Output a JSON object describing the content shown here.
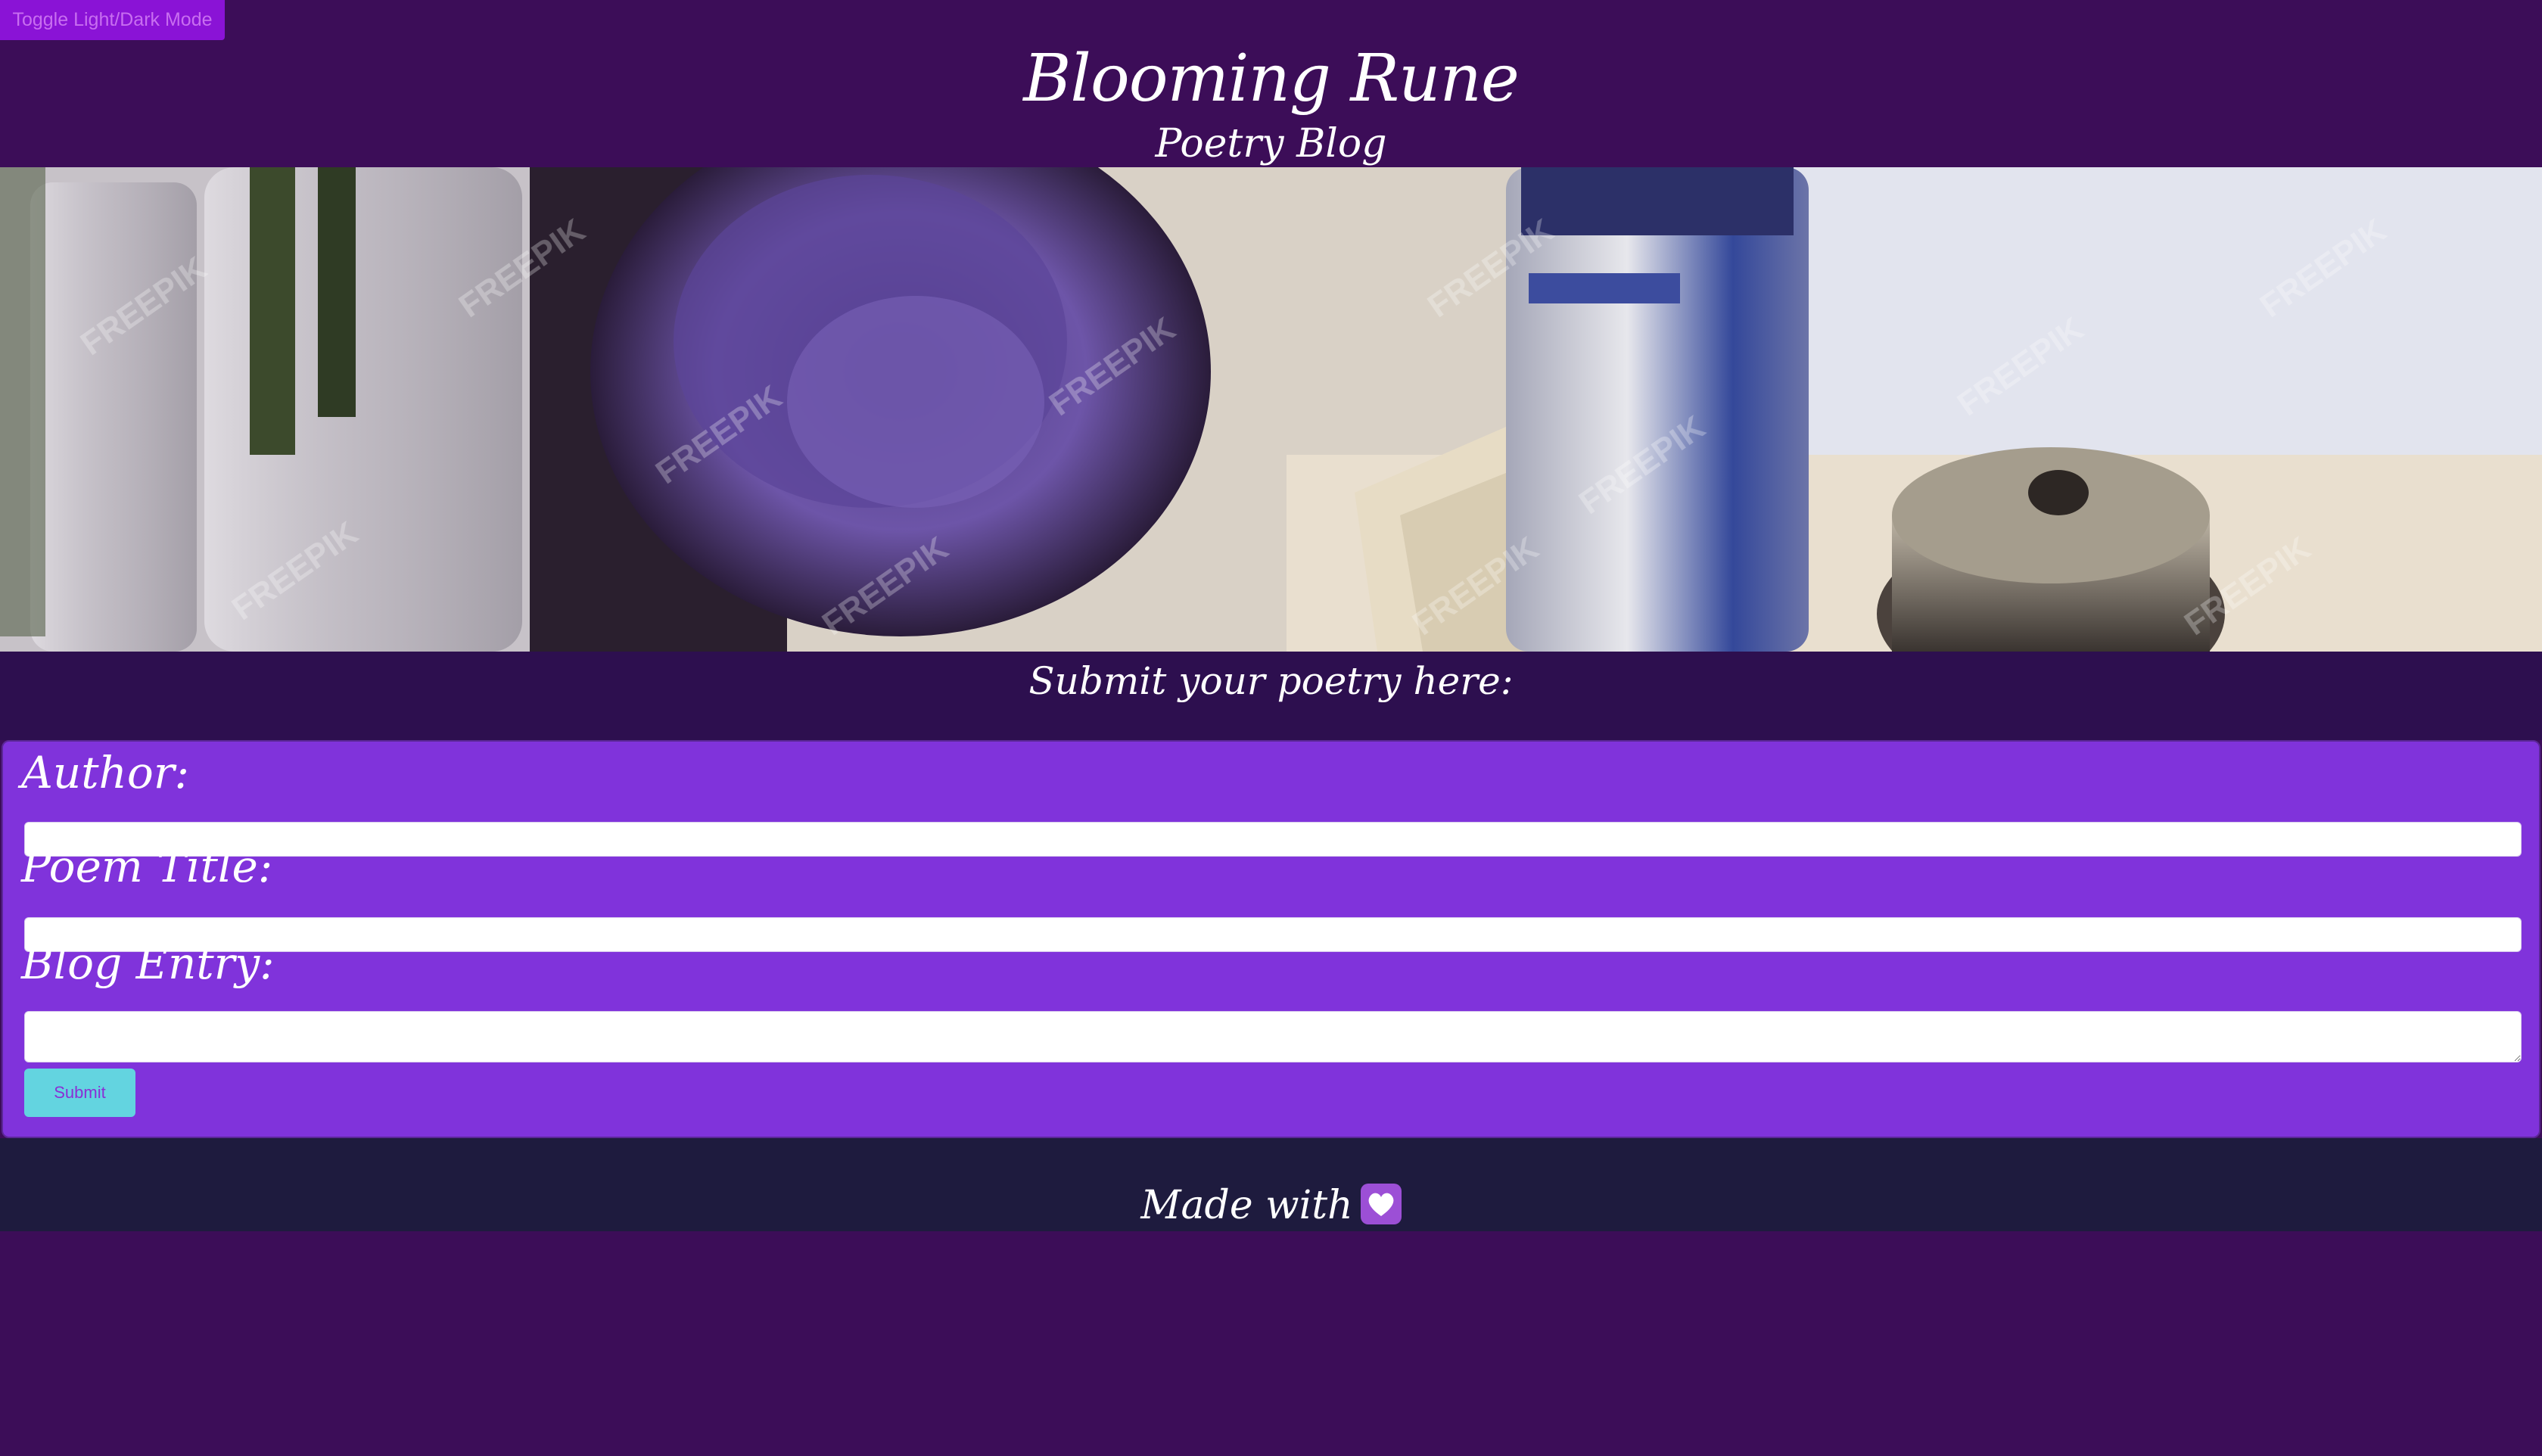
{
  "toggle": {
    "label": "Toggle Light/Dark Mode"
  },
  "header": {
    "title": "Blooming Rune",
    "subtitle": "Poetry Blog"
  },
  "hero": {
    "watermark": "FREEPIK"
  },
  "form": {
    "heading": "Submit your poetry here:",
    "author_label": "Author:",
    "author_value": "",
    "poem_title_label": "Poem Title:",
    "poem_title_value": "",
    "blog_entry_label": "Blog Entry:",
    "blog_entry_value": "",
    "submit_label": "Submit"
  },
  "footer": {
    "text": "Made with",
    "icon": "purple-heart-icon"
  },
  "colors": {
    "page_bg": "#3c0d58",
    "heading_band_bg": "#2d0f4f",
    "form_bg": "#8033db",
    "footer_bg": "#1e1b3e",
    "toggle_bg": "#8a13d6",
    "submit_bg": "#63d4e0",
    "text": "#ffffff"
  }
}
